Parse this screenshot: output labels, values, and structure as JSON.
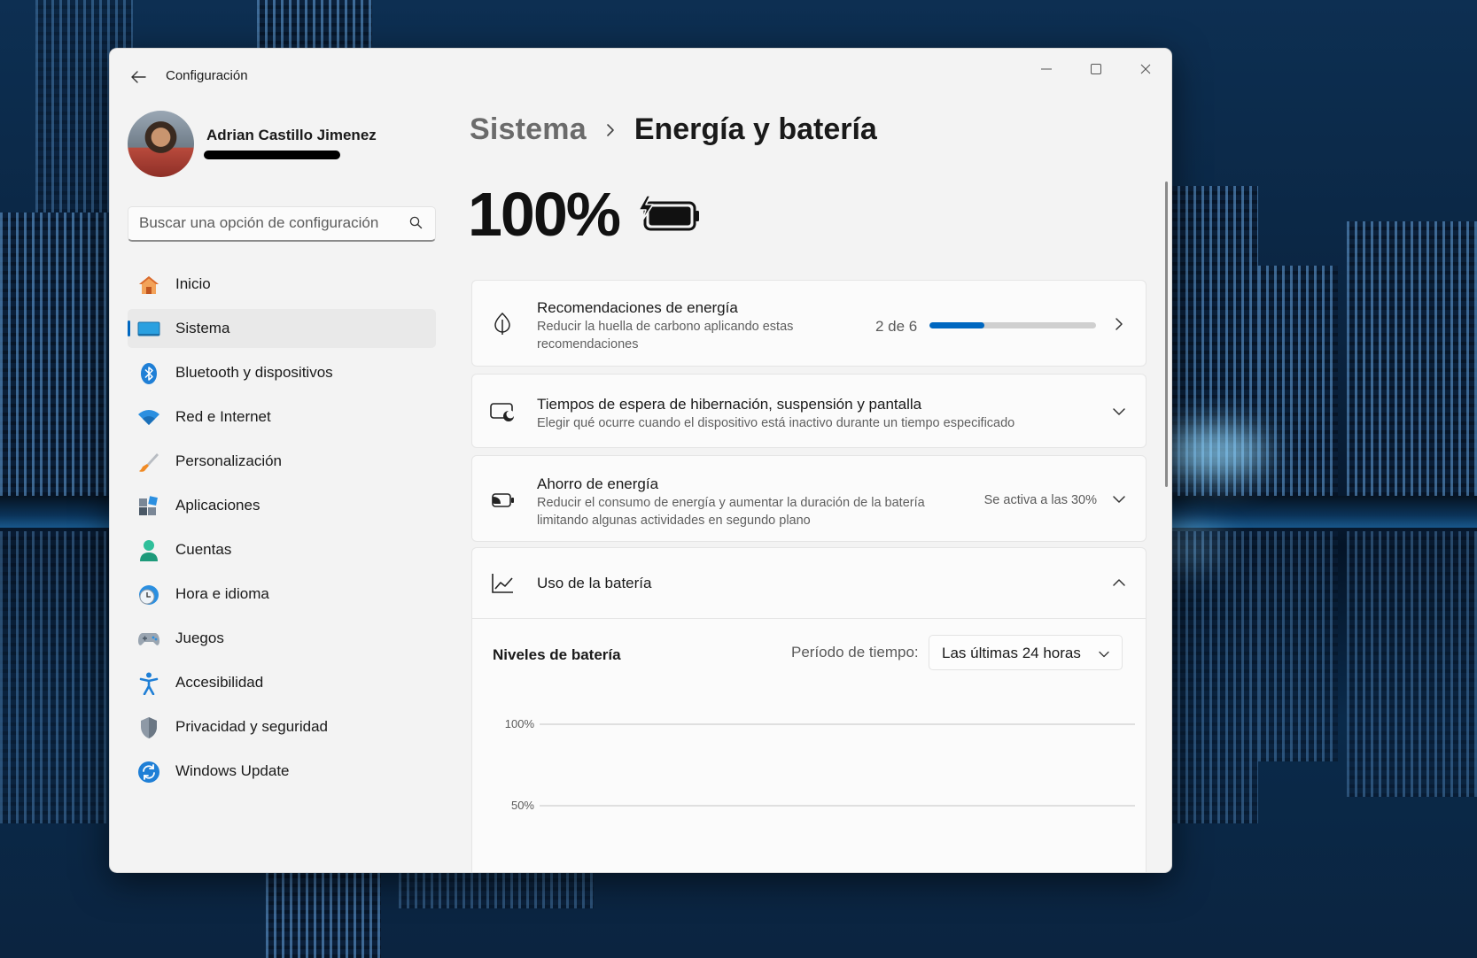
{
  "window": {
    "app_title": "Configuración"
  },
  "profile": {
    "name": "Adrian Castillo Jimenez"
  },
  "search": {
    "placeholder": "Buscar una opción de configuración"
  },
  "sidebar": {
    "items": [
      {
        "label": "Inicio",
        "icon": "home-icon"
      },
      {
        "label": "Sistema",
        "icon": "system-icon",
        "active": true
      },
      {
        "label": "Bluetooth y dispositivos",
        "icon": "bluetooth-icon"
      },
      {
        "label": "Red e Internet",
        "icon": "wifi-icon"
      },
      {
        "label": "Personalización",
        "icon": "brush-icon"
      },
      {
        "label": "Aplicaciones",
        "icon": "apps-icon"
      },
      {
        "label": "Cuentas",
        "icon": "account-icon"
      },
      {
        "label": "Hora e idioma",
        "icon": "clock-globe-icon"
      },
      {
        "label": "Juegos",
        "icon": "gamepad-icon"
      },
      {
        "label": "Accesibilidad",
        "icon": "accessibility-icon"
      },
      {
        "label": "Privacidad y seguridad",
        "icon": "shield-icon"
      },
      {
        "label": "Windows Update",
        "icon": "update-icon"
      }
    ]
  },
  "main": {
    "breadcrumb_parent": "Sistema",
    "breadcrumb_current": "Energía y batería",
    "battery_percent": "100%",
    "cards": {
      "recommendations": {
        "title": "Recomendaciones de energía",
        "subtitle_line1": "Reducir la huella de carbono aplicando estas",
        "subtitle_line2": "recomendaciones",
        "progress_text": "2 de 6",
        "progress_fraction": 0.33
      },
      "sleep": {
        "title": "Tiempos de espera de hibernación, suspensión y pantalla",
        "subtitle": "Elegir qué ocurre cuando el dispositivo está inactivo durante un tiempo especificado"
      },
      "saver": {
        "title": "Ahorro de energía",
        "subtitle_line1": "Reducir el consumo de energía y aumentar la duración de la batería",
        "subtitle_line2": "limitando algunas actividades en segundo plano",
        "value": "Se activa a las 30%"
      },
      "usage": {
        "title": "Uso de la batería",
        "levels_title": "Niveles de batería",
        "period_label": "Período de tiempo:",
        "period_value": "Las últimas 24 horas",
        "y_ticks": [
          "100%",
          "50%"
        ]
      }
    }
  },
  "colors": {
    "accent": "#0067c0",
    "window_bg": "#f3f3f3",
    "card_bg": "#fbfbfb"
  }
}
